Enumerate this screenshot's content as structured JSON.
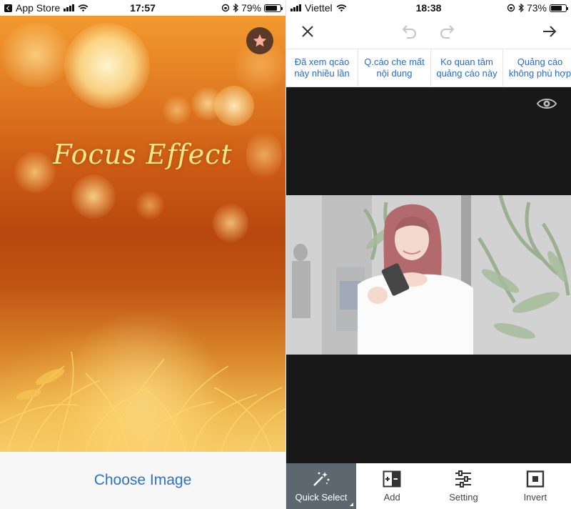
{
  "left_screen": {
    "status_bar": {
      "back_app": "App Store",
      "time": "17:57",
      "battery": "79%",
      "battery_level": 0.79
    },
    "hero_title": "Focus Effect",
    "favorite_icon": "star-icon",
    "choose_image_label": "Choose Image",
    "colors": {
      "accent": "#2b74c8",
      "title": "#ffe98a",
      "favorite_bg": "#5b3a2a"
    }
  },
  "right_screen": {
    "status_bar": {
      "carrier": "Viettel",
      "time": "18:38",
      "battery": "73%",
      "battery_level": 0.73
    },
    "toolbar": {
      "close_icon": "close-icon",
      "undo_icon": "undo-icon",
      "redo_icon": "redo-icon",
      "next_icon": "arrow-right-icon"
    },
    "ad_options": [
      {
        "label": "Đã xem qcáo\nnày nhiều lần"
      },
      {
        "label": "Q.cáo che mất\nnội dung"
      },
      {
        "label": "Ko quan tâm\nquảng cáo này"
      },
      {
        "label": "Quảng cáo\nkhông phù hợp"
      }
    ],
    "preview_icon": "eye-icon",
    "tabs": [
      {
        "label": "Quick Select",
        "icon": "magic-wand-icon",
        "active": true
      },
      {
        "label": "Add",
        "icon": "add-mask-icon",
        "active": false
      },
      {
        "label": "Setting",
        "icon": "sliders-icon",
        "active": false
      },
      {
        "label": "Invert",
        "icon": "invert-icon",
        "active": false
      }
    ],
    "colors": {
      "link": "#2e6bbf",
      "canvas": "#181818",
      "active_tab": "#5d6770"
    }
  }
}
